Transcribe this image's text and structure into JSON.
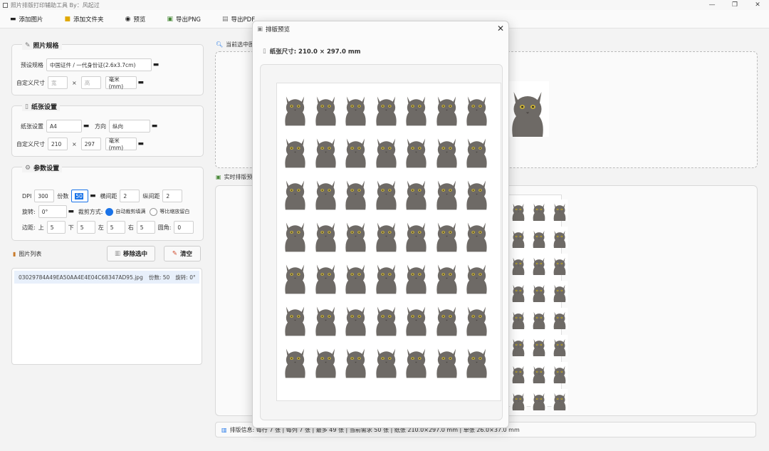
{
  "window": {
    "title": "照片排版打印辅助工具 By：风起过",
    "controls": [
      "—",
      "❐",
      "✕"
    ]
  },
  "toolbar": {
    "add_image": "添加图片",
    "add_folder": "添加文件夹",
    "preview": "预览",
    "export_png": "导出PNG",
    "export_pdf": "导出PDF"
  },
  "photo_spec": {
    "title": "照片规格",
    "preset_label": "预设规格",
    "preset_value": "中国证件 / 一代身份证(2.6x3.7cm)",
    "custom_label": "自定义尺寸",
    "width_placeholder": "宽",
    "height_placeholder": "高",
    "x": "×",
    "unit": "毫米(mm)"
  },
  "paper": {
    "title": "纸张设置",
    "paper_label": "纸张设置",
    "paper_value": "A4",
    "orientation_label": "方向",
    "orientation_value": "纵向",
    "custom_label": "自定义尺寸",
    "width": "210",
    "x": "×",
    "height": "297",
    "unit": "毫米(mm)"
  },
  "params": {
    "title": "参数设置",
    "dpi_label": "DPI",
    "dpi": "300",
    "copies_label": "份数",
    "copies": "50",
    "hgap_label": "横间距",
    "hgap": "2",
    "vgap_label": "纵间距",
    "vgap": "2",
    "rotate_label": "旋转:",
    "rotate": "0°",
    "crop_label": "裁剪方式:",
    "crop_auto": "自动裁剪填满",
    "crop_fit": "等比缩放留白",
    "margin_label": "边距:",
    "top_label": "上",
    "top": "5",
    "bottom_label": "下",
    "bottom": "5",
    "left_label": "左",
    "left": "5",
    "right_label": "右",
    "right": "5",
    "corner_label": "圆角:",
    "corner": "0"
  },
  "image_list": {
    "title": "图片列表",
    "remove_btn": "移除选中",
    "clear_btn": "清空",
    "items": [
      {
        "name": "03029784A49EA50AA4E4E04C68347AD95.jpg",
        "copies": "份数: 50",
        "rotate": "旋转: 0°"
      }
    ]
  },
  "right": {
    "current_label": "当前选中图片",
    "layout_label": "实时排版预览",
    "status": "排版信息: 每行 7 张 | 每列 7 张 | 最多 49 张 | 当前需求 50 张 | 纸张 210.0×297.0 mm | 单张 26.0×37.0 mm"
  },
  "dialog": {
    "title": "排版预览",
    "close": "✕",
    "paper_size": "纸张尺寸: 210.0 × 297.0 mm",
    "grid_rows": 7,
    "grid_cols": 7
  },
  "colors": {
    "accent": "#1a73e8",
    "selected_row": "#e8f0fb",
    "cat_fur": "#6e6a66",
    "cat_eye": "#c9b13a"
  }
}
